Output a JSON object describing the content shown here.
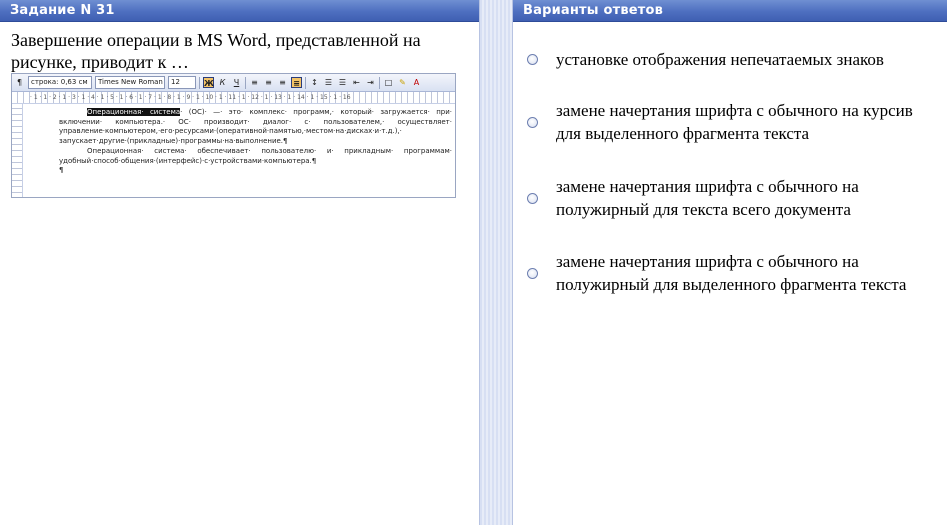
{
  "left_panel": {
    "header": "Задание N 31",
    "question": [
      "Завершение операции в MS Word, представленной на",
      "рисунке, приводит к …"
    ]
  },
  "right_panel": {
    "header": "Варианты ответов"
  },
  "word_screenshot": {
    "style_box": "строка: 0,63 см",
    "font_box": "Times New Roman",
    "size_box": "12",
    "bold_button": "Ж",
    "italic_button": "К",
    "underline_button": "Ч",
    "ruler_text": "· 1 · 1 · 2 · 1 · 3 · 1 · 4 · 1 · 5 · 1 · 6 · 1 · 7 · 1 · 8 · 1 · 9 · 1 · 10 · 1 · 11 · 1 · 12 · 1 · 13 · 1 · 14 · 1 · 15 · 1 · 16",
    "highlighted": "Операционная· система",
    "para1_rest": "· (ОС)· —· это· комплекс· программ,· который· загружается· при· включении· компьютера.· ОС· производит· диалог· с· пользователем,· осуществляет· управление·компьютером,·его·ресурсами·(оперативной·памятью,·местом·на·дисках·и·т.д.),· запускает·другие·(прикладные)·программы·на·выполнение.¶",
    "para2": "Операционная· система· обеспечивает· пользователю· и· прикладным· программам· удобный·способ·общения·(интерфейс)·с·устройствами·компьютера.¶",
    "para3": "¶"
  },
  "answers": [
    {
      "lines": [
        "установке отображения непечатаемых знаков"
      ]
    },
    {
      "lines": [
        "замене начертания шрифта с обычного на курсив",
        "для выделенного фрагмента текста"
      ]
    },
    {
      "lines": [
        "замене начертания шрифта с обычного на",
        "полужирный для текста всего документа"
      ]
    },
    {
      "lines": [
        "замене начертания шрифта с обычного на",
        "полужирный для выделенного фрагмента текста"
      ]
    }
  ],
  "colors": {
    "header_blue": "#4e6fc0",
    "divider": "#dfe6f6"
  }
}
